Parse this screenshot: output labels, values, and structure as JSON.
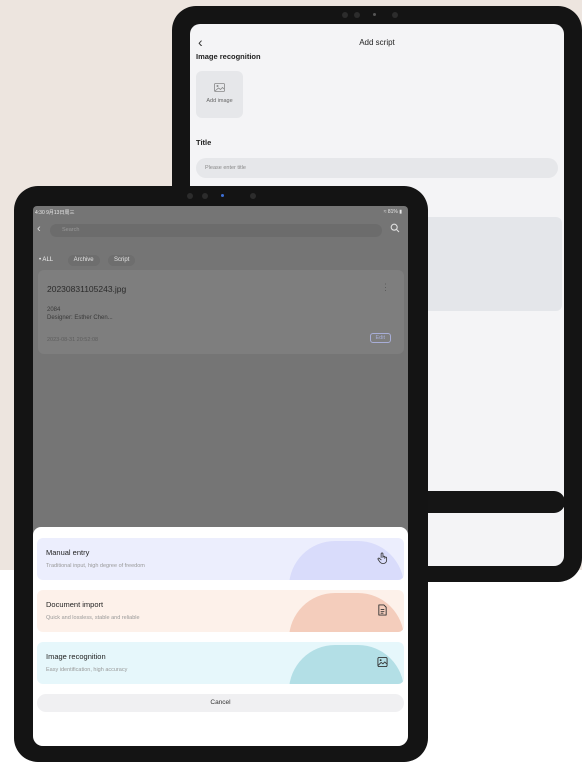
{
  "back_screen": {
    "title": "Add script",
    "section_image": "Image recognition",
    "add_image_label": "Add image",
    "section_title": "Title",
    "title_placeholder": "Please enter title"
  },
  "front_screen": {
    "status": {
      "time": "4:30 9月13日周三",
      "battery": "81%"
    },
    "search_placeholder": "Search",
    "filters": [
      "• ALL",
      "Archive",
      "Script"
    ],
    "file_card": {
      "name": "20230831105243.jpg",
      "line1": "2084",
      "line2": "Designer: Esther Chen...",
      "date": "2023-08-31 20:52:08",
      "edit_label": "Edit"
    },
    "sheet": {
      "options": [
        {
          "title": "Manual entry",
          "subtitle": "Traditional input, high degree of freedom",
          "icon": "hand-pointer-icon",
          "bg": "#eceefd",
          "blob": "#d9dcfb"
        },
        {
          "title": "Document import",
          "subtitle": "Quick and lossless, stable and reliable",
          "icon": "document-icon",
          "bg": "#fdf1ea",
          "blob": "#f4cdbc"
        },
        {
          "title": "Image recognition",
          "subtitle": "Easy identification, high accuracy",
          "icon": "image-icon",
          "bg": "#e6f7fb",
          "blob": "#b3dfe6"
        }
      ],
      "cancel_label": "Cancel"
    }
  }
}
